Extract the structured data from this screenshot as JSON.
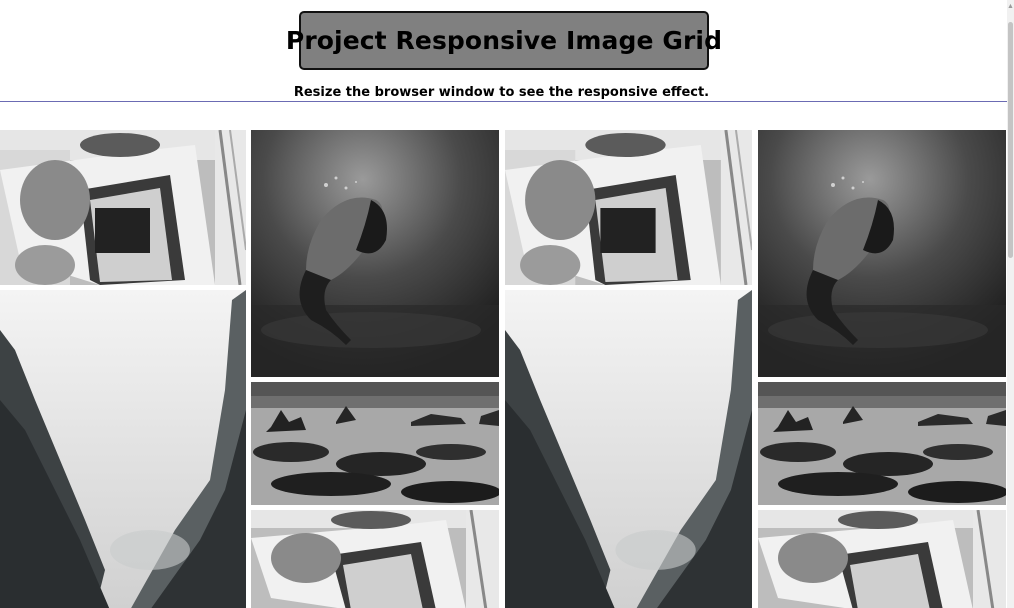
{
  "header": {
    "title": "Project Responsive Image Grid",
    "subtitle": "Resize the browser window to see the responsive effect."
  },
  "grid": {
    "columns": [
      {
        "tiles": [
          "car-photo",
          "foggy-cliff-photo"
        ]
      },
      {
        "tiles": [
          "underwater-photo",
          "rocky-shore-photo",
          "car-photo"
        ]
      },
      {
        "tiles": [
          "car-photo",
          "foggy-cliff-photo"
        ]
      },
      {
        "tiles": [
          "underwater-photo",
          "rocky-shore-photo",
          "car-photo"
        ]
      }
    ]
  },
  "colors": {
    "title_background": "#808080",
    "rule": "#6b6bb3"
  }
}
